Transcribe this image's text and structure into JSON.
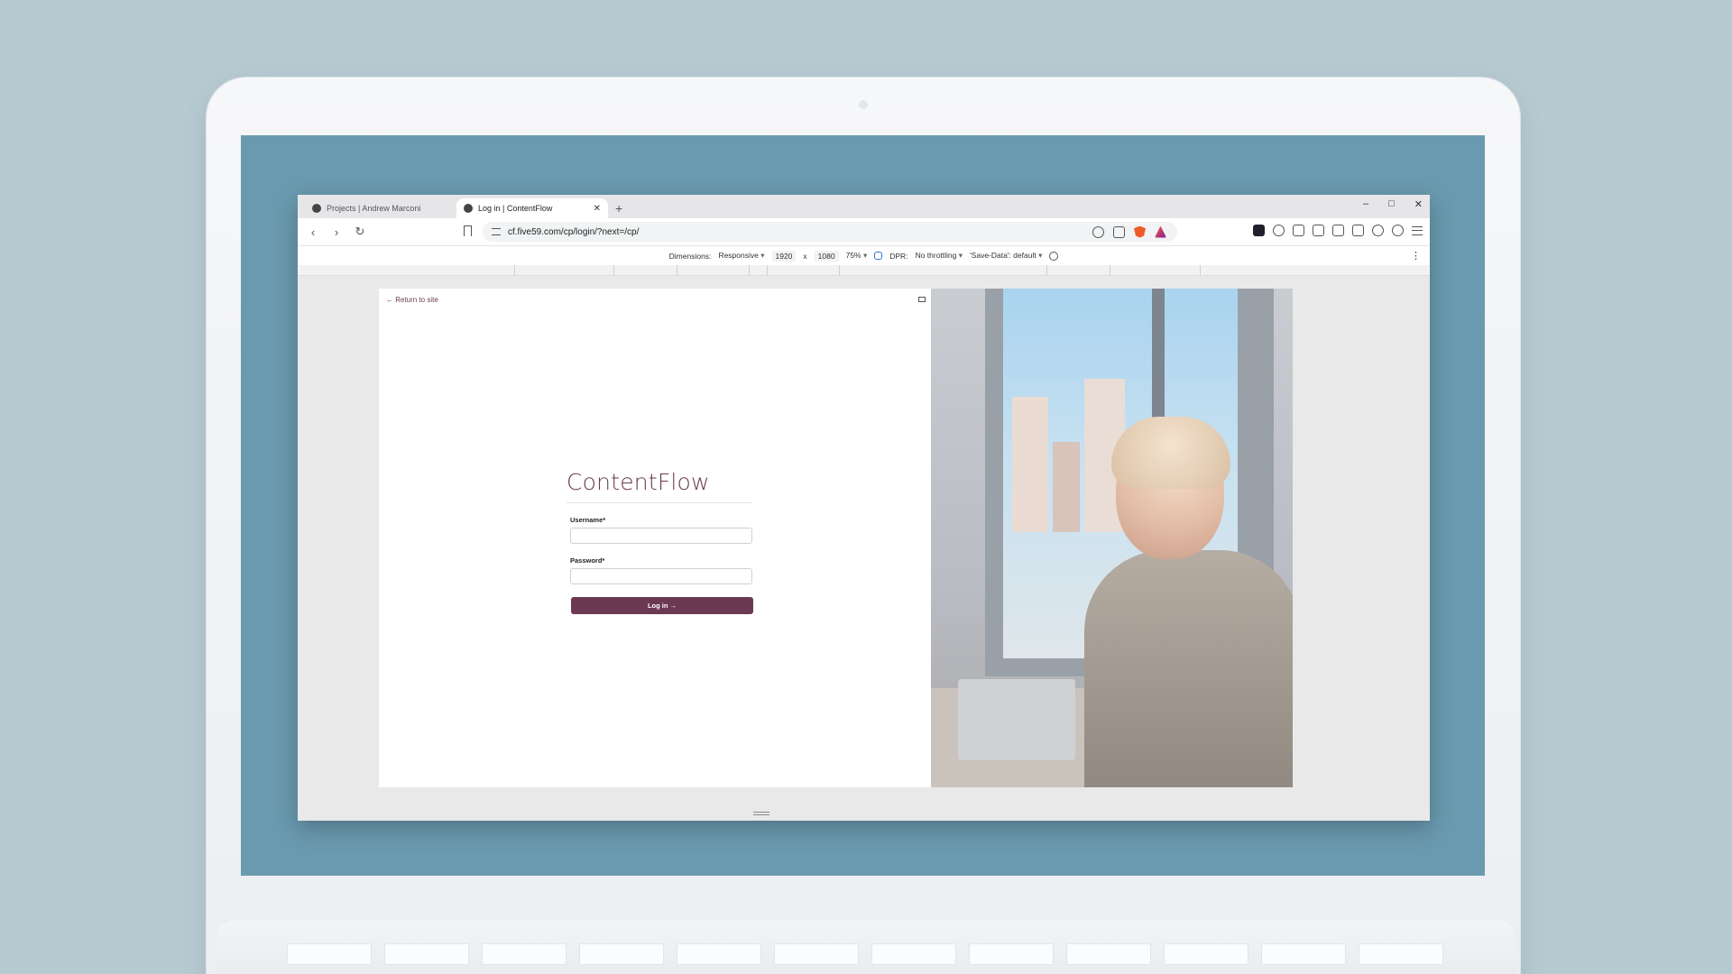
{
  "browser": {
    "tabs": [
      {
        "label": "Projects | Andrew Marconi",
        "active": false
      },
      {
        "label": "Log in | ContentFlow",
        "active": true
      }
    ],
    "new_tab": "+",
    "window_controls": {
      "minimize": "–",
      "maximize": "□",
      "close": "✕"
    },
    "url": "cf.five59.com/cp/login/?next=/cp/"
  },
  "devtools": {
    "dimensions_label": "Dimensions:",
    "device": "Responsive",
    "width": "1920",
    "times": "x",
    "height": "1080",
    "zoom": "75%",
    "dpr_label": "DPR:",
    "throttling": "No throttling",
    "save_data": "'Save-Data': default"
  },
  "page": {
    "return_link": "← Return to site",
    "brand": "ContentFlow",
    "username_label": "Username*",
    "password_label": "Password*",
    "login_button": "Log in →"
  },
  "colors": {
    "brand": "#6b3a52",
    "screen_bg": "#6a9aaf",
    "desk_bg": "#b7cad2"
  }
}
